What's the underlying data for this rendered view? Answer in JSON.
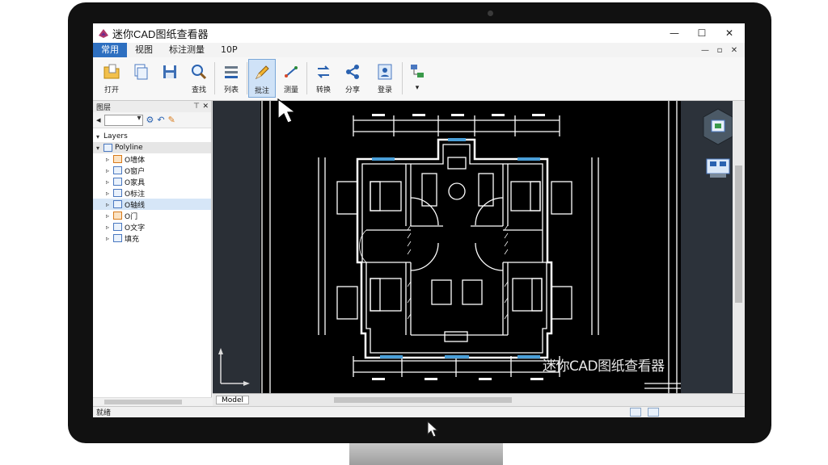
{
  "window": {
    "title": "迷你CAD图纸查看器",
    "controls": {
      "minimize": "—",
      "maximize": "☐",
      "close": "✕"
    }
  },
  "menu": {
    "items": [
      {
        "label": "常用",
        "active": true
      },
      {
        "label": "视图"
      },
      {
        "label": "标注测量"
      },
      {
        "label": "10P"
      }
    ],
    "mdi_controls": [
      "—",
      "▫",
      "✕"
    ]
  },
  "ribbon": {
    "buttons": [
      {
        "label": "打开",
        "icon": "open-folder-icon"
      },
      {
        "label": "",
        "icon": "copy-pages-icon"
      },
      {
        "label": "",
        "icon": "save-icon"
      },
      {
        "label": "查找",
        "icon": "search-icon"
      },
      {
        "label": "列表",
        "icon": "list-icon"
      },
      {
        "label": "批注",
        "icon": "pencil-icon",
        "pressed": true
      },
      {
        "label": "测量",
        "icon": "measure-icon"
      },
      {
        "label": "转换",
        "icon": "convert-icon"
      },
      {
        "label": "分享",
        "icon": "share-icon"
      },
      {
        "label": "登录",
        "icon": "user-icon"
      },
      {
        "label": "",
        "icon": "network-icon"
      }
    ]
  },
  "layers_panel": {
    "title": "图层",
    "tree": [
      {
        "label": "Layers",
        "level": 0,
        "arrow": "▾"
      },
      {
        "label": "Polyline",
        "level": 0,
        "arrow": "▾",
        "icon": "folder"
      },
      {
        "label": "O墙体",
        "level": 1,
        "arrow": "▹",
        "icon": "orange"
      },
      {
        "label": "O窗户",
        "level": 1,
        "arrow": "▹"
      },
      {
        "label": "O家具",
        "level": 1,
        "arrow": "▹"
      },
      {
        "label": "O标注",
        "level": 1,
        "arrow": "▹"
      },
      {
        "label": "O轴线",
        "level": 1,
        "arrow": "▹",
        "selected": true
      },
      {
        "label": "O门",
        "level": 1,
        "arrow": "▹",
        "icon": "orange"
      },
      {
        "label": "O文字",
        "level": 1,
        "arrow": "▹"
      },
      {
        "label": "填充",
        "level": 1,
        "arrow": "▹"
      }
    ]
  },
  "canvas": {
    "watermark": "迷你CAD图纸查看器",
    "bg_color": "#000000",
    "line_color": "#ffffff",
    "window_color": "#4a9fd8"
  },
  "bottom_bar": {
    "tab": "Model"
  },
  "status": {
    "text": "就绪"
  },
  "colors": {
    "accent": "#2d6fc0",
    "bezel": "#111111"
  }
}
